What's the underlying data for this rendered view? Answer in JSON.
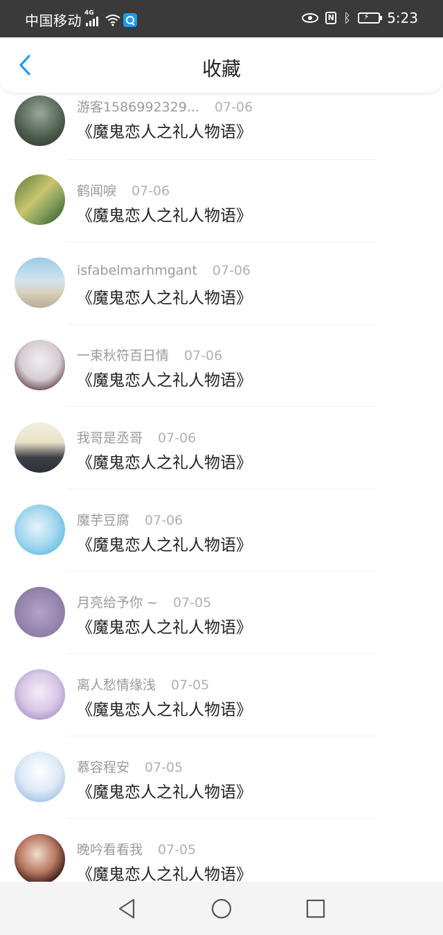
{
  "status_bar": {
    "carrier": "中国移动",
    "network": "4G",
    "time": "5:23"
  },
  "header": {
    "title": "收藏",
    "back_icon": "chevron-left-icon"
  },
  "colors": {
    "accent": "#1e9bf0",
    "status_bar_bg": "#3a3a3a",
    "nav_bar_bg": "#f4f4f4"
  },
  "list": [
    {
      "user": "游客1586992329...",
      "date": "07-06",
      "title": "《魔鬼恋人之礼人物语》"
    },
    {
      "user": "鹤闻唳",
      "date": "07-06",
      "title": "《魔鬼恋人之礼人物语》"
    },
    {
      "user": "isfabelmarhmgant",
      "date": "07-06",
      "title": "《魔鬼恋人之礼人物语》"
    },
    {
      "user": "一束秋符百日情",
      "date": "07-06",
      "title": "《魔鬼恋人之礼人物语》"
    },
    {
      "user": "我哥是丞哥",
      "date": "07-06",
      "title": "《魔鬼恋人之礼人物语》"
    },
    {
      "user": "魔芋豆腐",
      "date": "07-06",
      "title": "《魔鬼恋人之礼人物语》"
    },
    {
      "user": "月亮给予你 ~",
      "date": "07-05",
      "title": "《魔鬼恋人之礼人物语》"
    },
    {
      "user": "离人愁情缘浅",
      "date": "07-05",
      "title": "《魔鬼恋人之礼人物语》"
    },
    {
      "user": "慕容程安",
      "date": "07-05",
      "title": "《魔鬼恋人之礼人物语》"
    },
    {
      "user": "晚吟看看我",
      "date": "07-05",
      "title": "《魔鬼恋人之礼人物语》"
    }
  ],
  "nav_bar": {
    "back_icon": "triangle-back-icon",
    "home_icon": "circle-home-icon",
    "recent_icon": "square-recents-icon"
  }
}
